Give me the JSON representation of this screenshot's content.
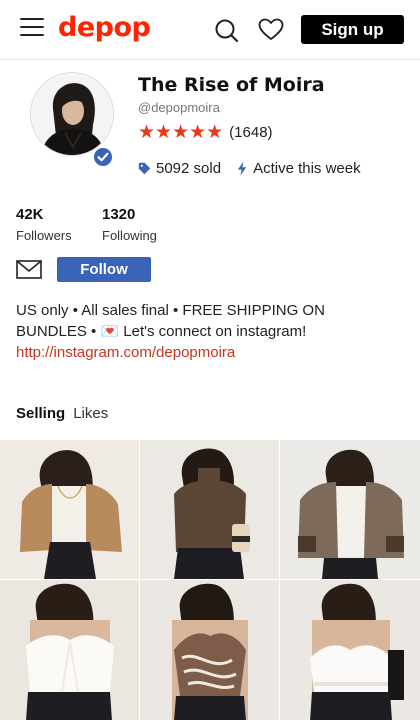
{
  "header": {
    "logo": "depop",
    "signup_label": "Sign up"
  },
  "profile": {
    "shop_name": "The Rise of Moira",
    "handle": "@depopmoira",
    "stars": "★★★★★",
    "rating_value": 5,
    "review_count": "(1648)",
    "sold": "5092 sold",
    "activity": "Active this week",
    "followers_count": "42K",
    "followers_label": "Followers",
    "following_count": "1320",
    "following_label": "Following",
    "follow_label": "Follow",
    "bio_line1": "US only • All sales final • FREE SHIPPING ON",
    "bio_line2": "BUNDLES • 💌 Let's connect on instagram!",
    "bio_link": "http://instagram.com/depopmoira"
  },
  "tabs": [
    {
      "label": "Selling",
      "active": true
    },
    {
      "label": "Likes",
      "active": false
    }
  ],
  "colors": {
    "brand": "#ff2300",
    "accent": "#3a63b8",
    "stars": "#e8391b",
    "link": "#c8351e"
  },
  "icons": {
    "menu": "menu-icon",
    "search": "search-icon",
    "heart": "heart-icon",
    "verified": "verified-badge-icon",
    "tag": "price-tag-icon",
    "bolt": "lightning-bolt-icon",
    "mail": "mail-icon"
  },
  "listings": [
    {
      "item": "tan suede cropped jacket"
    },
    {
      "item": "brown mock neck bodysuit"
    },
    {
      "item": "brown corduroy jacket with fur cuffs"
    },
    {
      "item": "white lace tie-front top"
    },
    {
      "item": "swirl print halter top"
    },
    {
      "item": "white lace camisole top"
    }
  ]
}
